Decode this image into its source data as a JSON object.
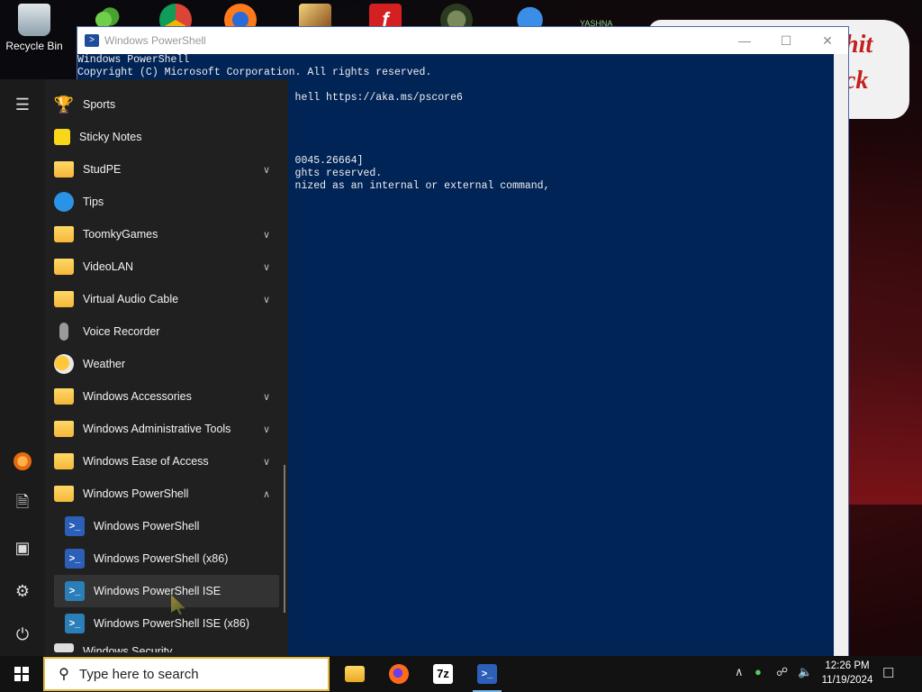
{
  "desktop": {
    "recycle_bin_label": "Recycle Bin",
    "top_icons": [
      "contacts-app-icon",
      "chrome-icon",
      "firefox-style-icon",
      "game-icon",
      "flash-icon",
      "emblem-icon",
      "sonic-icon",
      "yashna-icon"
    ],
    "top_icon_text": "YASHNA",
    "banner_text_1": "hit",
    "banner_text_2": "ck"
  },
  "powershell": {
    "title": "Windows PowerShell",
    "lines": [
      "Windows PowerShell",
      "Copyright (C) Microsoft Corporation. All rights reserved.",
      "",
      "                                   hell https://aka.ms/pscore6",
      "",
      "",
      "",
      "",
      "                                   0045.26664]",
      "                                   ghts reserved.",
      "                                   nized as an internal or external command,"
    ]
  },
  "start_menu": {
    "items": [
      {
        "label": "Sports",
        "icon": "trophy",
        "expandable": false
      },
      {
        "label": "Sticky Notes",
        "icon": "sticky",
        "expandable": false
      },
      {
        "label": "StudPE",
        "icon": "folder",
        "expandable": true
      },
      {
        "label": "Tips",
        "icon": "tips",
        "expandable": false
      },
      {
        "label": "ToomkyGames",
        "icon": "folder",
        "expandable": true
      },
      {
        "label": "VideoLAN",
        "icon": "folder",
        "expandable": true
      },
      {
        "label": "Virtual Audio Cable",
        "icon": "folder",
        "expandable": true
      },
      {
        "label": "Voice Recorder",
        "icon": "mic",
        "expandable": false
      },
      {
        "label": "Weather",
        "icon": "weather",
        "expandable": false
      },
      {
        "label": "Windows Accessories",
        "icon": "folder",
        "expandable": true
      },
      {
        "label": "Windows Administrative Tools",
        "icon": "folder",
        "expandable": true
      },
      {
        "label": "Windows Ease of Access",
        "icon": "folder",
        "expandable": true
      },
      {
        "label": "Windows PowerShell",
        "icon": "folder",
        "expandable": true,
        "expanded": true
      },
      {
        "label": "Windows PowerShell",
        "icon": "ps",
        "sub": true
      },
      {
        "label": "Windows PowerShell (x86)",
        "icon": "ps",
        "sub": true
      },
      {
        "label": "Windows PowerShell ISE",
        "icon": "ise",
        "sub": true,
        "hover": true
      },
      {
        "label": "Windows PowerShell ISE (x86)",
        "icon": "ise",
        "sub": true
      },
      {
        "label": "Windows Security",
        "icon": "shield",
        "partial": true
      }
    ]
  },
  "taskbar": {
    "search_placeholder": "Type here to search",
    "apps": [
      "file-explorer-icon",
      "firefox-icon",
      "7zip-icon",
      "powershell-icon"
    ],
    "sevenzip_text": "7z",
    "clock_time": "12:26 PM",
    "clock_date": "11/19/2024"
  },
  "colors": {
    "console_bg": "#012456",
    "start_bg": "#202020",
    "taskbar_bg": "#121212",
    "search_border": "#e0b940"
  }
}
